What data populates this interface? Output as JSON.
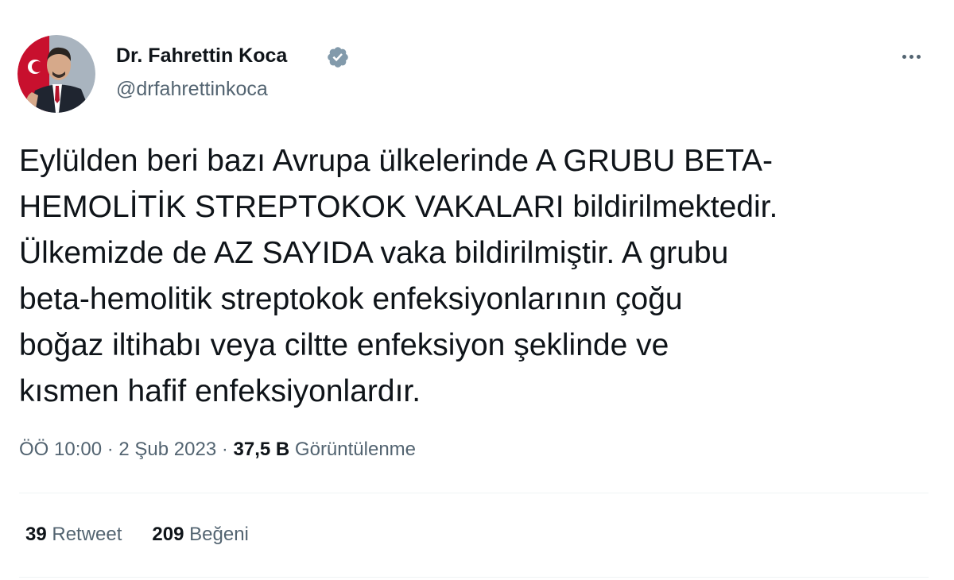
{
  "author": {
    "display_name": "Dr. Fahrettin Koca",
    "handle": "@drfahrettinkoca",
    "avatar_icon": "profile-avatar",
    "verified_icon": "verified-badge-icon",
    "verified_color": "#829aab"
  },
  "tweet": {
    "lines": [
      "Eylülden beri bazı Avrupa ülkelerinde A GRUBU BETA-",
      "HEMOLİTİK STREPTOKOK VAKALARI bildirilmektedir.",
      "Ülkemizde de AZ SAYIDA vaka bildirilmiştir. A grubu",
      "beta-hemolitik streptokok enfeksiyonlarının çoğu",
      "boğaz iltihabı veya ciltte enfeksiyon şeklinde ve",
      "kısmen hafif enfeksiyonlardır."
    ]
  },
  "meta": {
    "time": "ÖÖ 10:00",
    "separator": "·",
    "date": "2 Şub 2023",
    "views_count": "37,5 B",
    "views_label": "Görüntülenme"
  },
  "stats": {
    "retweets_count": "39",
    "retweets_label": "Retweet",
    "likes_count": "209",
    "likes_label": "Beğeni"
  },
  "menu_icon": "more-options-icon",
  "colors": {
    "text_primary": "#0f1419",
    "text_secondary": "#536471",
    "divider": "#eff3f4"
  }
}
